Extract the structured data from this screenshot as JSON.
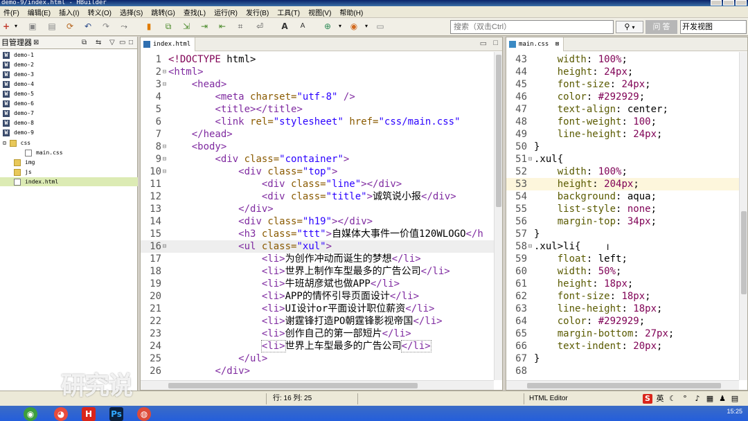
{
  "window": {
    "title": "demo-9/index.html - HBuilder"
  },
  "menu": [
    "件(F)",
    "编辑(E)",
    "插入(I)",
    "转义(O)",
    "选择(S)",
    "跳转(G)",
    "查找(L)",
    "运行(R)",
    "发行(B)",
    "工具(T)",
    "视图(V)",
    "帮助(H)"
  ],
  "toolbar": {
    "search_placeholder": "搜索（双击Ctrl）",
    "ask_label": "问 答",
    "perspective_label": "开发视图"
  },
  "project": {
    "title": "目管理器",
    "items": [
      {
        "label": "demo-1",
        "type": "project"
      },
      {
        "label": "demo-2",
        "type": "project"
      },
      {
        "label": "demo-3",
        "type": "project"
      },
      {
        "label": "demo-4",
        "type": "project"
      },
      {
        "label": "demo-5",
        "type": "project"
      },
      {
        "label": "demo-6",
        "type": "project"
      },
      {
        "label": "demo-7",
        "type": "project"
      },
      {
        "label": "demo-8",
        "type": "project"
      },
      {
        "label": "demo-9",
        "type": "project"
      },
      {
        "label": "css",
        "type": "folder",
        "expand": "⊟"
      },
      {
        "label": "main.css",
        "type": "file"
      },
      {
        "label": "img",
        "type": "folder"
      },
      {
        "label": "js",
        "type": "folder"
      },
      {
        "label": "index.html",
        "type": "file",
        "selected": true
      }
    ]
  },
  "html_editor": {
    "tab": "index.html",
    "lines": [
      {
        "n": "1",
        "fold": "",
        "html": "<span class=\"kw\">&lt;!DOCTYPE</span> <span class=\"txt\">html&gt;</span>"
      },
      {
        "n": "2",
        "fold": "⊟",
        "html": "<span class=\"tag\">&lt;html&gt;</span>"
      },
      {
        "n": "3",
        "fold": "⊟",
        "html": "    <span class=\"tag\">&lt;head&gt;</span>"
      },
      {
        "n": "4",
        "fold": "",
        "html": "        <span class=\"tag\">&lt;meta</span> <span class=\"attr\">charset=</span><span class=\"val\">\"utf-8\"</span> <span class=\"tag\">/&gt;</span>"
      },
      {
        "n": "5",
        "fold": "",
        "html": "        <span class=\"tag\">&lt;title&gt;&lt;/title&gt;</span>"
      },
      {
        "n": "6",
        "fold": "",
        "html": "        <span class=\"tag\">&lt;link</span> <span class=\"attr\">rel=</span><span class=\"val\">\"stylesheet\"</span> <span class=\"attr\">href=</span><span class=\"val\">\"css/main.css\"</span>"
      },
      {
        "n": "7",
        "fold": "",
        "html": "    <span class=\"tag\">&lt;/head&gt;</span>"
      },
      {
        "n": "8",
        "fold": "⊟",
        "html": "    <span class=\"tag\">&lt;body&gt;</span>"
      },
      {
        "n": "9",
        "fold": "⊟",
        "html": "        <span class=\"tag\">&lt;div</span> <span class=\"attr\">class=</span><span class=\"val\">\"container\"</span><span class=\"tag\">&gt;</span>"
      },
      {
        "n": "10",
        "fold": "⊟",
        "html": "            <span class=\"tag\">&lt;div</span> <span class=\"attr\">class=</span><span class=\"val\">\"top\"</span><span class=\"tag\">&gt;</span>"
      },
      {
        "n": "11",
        "fold": "",
        "html": "                <span class=\"tag\">&lt;div</span> <span class=\"attr\">class=</span><span class=\"val\">\"line\"</span><span class=\"tag\">&gt;&lt;/div&gt;</span>"
      },
      {
        "n": "12",
        "fold": "",
        "html": "                <span class=\"tag\">&lt;div</span> <span class=\"attr\">class=</span><span class=\"val\">\"title\"</span><span class=\"tag\">&gt;</span><span class=\"txt\">诚筑说小报</span><span class=\"tag\">&lt;/div&gt;</span>"
      },
      {
        "n": "13",
        "fold": "",
        "html": "            <span class=\"tag\">&lt;/div&gt;</span>"
      },
      {
        "n": "14",
        "fold": "",
        "html": "            <span class=\"tag\">&lt;div</span> <span class=\"attr\">class=</span><span class=\"val\">\"h19\"</span><span class=\"tag\">&gt;&lt;/div&gt;</span>"
      },
      {
        "n": "15",
        "fold": "",
        "html": "            <span class=\"tag\">&lt;h3</span> <span class=\"attr\">class=</span><span class=\"val\">\"ttt\"</span><span class=\"tag\">&gt;</span><span class=\"txt\">自媒体大事件一价值120WLOGO</span><span class=\"tag\">&lt;/h</span>"
      },
      {
        "n": "16",
        "fold": "⊟",
        "html": "            <span class=\"tag\">&lt;ul</span> <span class=\"attr\">class=</span><span class=\"val\">\"xul\"</span><span class=\"tag\">&gt;</span>",
        "hl": true
      },
      {
        "n": "17",
        "fold": "",
        "html": "                <span class=\"tag\">&lt;li&gt;</span><span class=\"txt\">为创作冲动而诞生的梦想</span><span class=\"tag\">&lt;/li&gt;</span>"
      },
      {
        "n": "18",
        "fold": "",
        "html": "                <span class=\"tag\">&lt;li&gt;</span><span class=\"txt\">世界上制作车型最多的广告公司</span><span class=\"tag\">&lt;/li&gt;</span>"
      },
      {
        "n": "19",
        "fold": "",
        "html": "                <span class=\"tag\">&lt;li&gt;</span><span class=\"txt\">牛班胡彦斌也做APP</span><span class=\"tag\">&lt;/li&gt;</span>"
      },
      {
        "n": "20",
        "fold": "",
        "html": "                <span class=\"tag\">&lt;li&gt;</span><span class=\"txt\">APP的情怀引导页面设计</span><span class=\"tag\">&lt;/li&gt;</span>"
      },
      {
        "n": "21",
        "fold": "",
        "html": "                <span class=\"tag\">&lt;li&gt;</span><span class=\"txt\">UI设计or平面设计职位薪资</span><span class=\"tag\">&lt;/li&gt;</span>"
      },
      {
        "n": "22",
        "fold": "",
        "html": "                <span class=\"tag\">&lt;li&gt;</span><span class=\"txt\">谢霆锋打造PO朝霆锋影视帝国</span><span class=\"tag\">&lt;/li&gt;</span>"
      },
      {
        "n": "23",
        "fold": "",
        "html": "                <span class=\"tag\">&lt;li&gt;</span><span class=\"txt\">创作自己的第一部短片</span><span class=\"tag\">&lt;/li&gt;</span>"
      },
      {
        "n": "24",
        "fold": "",
        "html": "                <span class=\"tag\" style=\"outline:1px dotted #888\">&lt;li&gt;</span><span class=\"txt\">世界上车型最多的广告公司</span><span class=\"tag\" style=\"outline:1px dotted #888\">&lt;/li&gt;</span>"
      },
      {
        "n": "25",
        "fold": "",
        "html": "            <span class=\"tag\">&lt;/ul&gt;</span>"
      },
      {
        "n": "26",
        "fold": "",
        "html": "        <span class=\"tag\">&lt;/div&gt;</span>"
      }
    ]
  },
  "css_editor": {
    "tab": "main.css",
    "lines": [
      {
        "n": "43",
        "fold": "",
        "html": "    <span class=\"prop\">width</span>: <span class=\"num\">100%</span>;"
      },
      {
        "n": "44",
        "fold": "",
        "html": "    <span class=\"prop\">height</span>: <span class=\"num\">24px</span>;"
      },
      {
        "n": "45",
        "fold": "",
        "html": "    <span class=\"prop\">font-size</span>: <span class=\"num\">24px</span>;"
      },
      {
        "n": "46",
        "fold": "",
        "html": "    <span class=\"prop\">color</span>: <span class=\"hex\">#292929</span>;"
      },
      {
        "n": "47",
        "fold": "",
        "html": "    <span class=\"prop\">text-align</span>: <span class=\"txt\">center</span>;"
      },
      {
        "n": "48",
        "fold": "",
        "html": "    <span class=\"prop\">font-weight</span>: <span class=\"num\">100</span>;"
      },
      {
        "n": "49",
        "fold": "",
        "html": "    <span class=\"prop\">line-height</span>: <span class=\"num\">24px</span>;"
      },
      {
        "n": "50",
        "fold": "",
        "html": "}"
      },
      {
        "n": "51",
        "fold": "⊟",
        "html": "<span class=\"sel\">.xul</span>{"
      },
      {
        "n": "52",
        "fold": "",
        "html": "    <span class=\"prop\">width</span>: <span class=\"num\">100%</span>;"
      },
      {
        "n": "53",
        "fold": "",
        "html": "    <span class=\"prop\">height</span>: <span class=\"num\">204px</span>;",
        "hl": true
      },
      {
        "n": "54",
        "fold": "",
        "html": "    <span class=\"prop\">background</span>: <span class=\"txt\">aqua</span>;"
      },
      {
        "n": "55",
        "fold": "",
        "html": "    <span class=\"prop\">list-style</span>: <span class=\"num\">none</span>;"
      },
      {
        "n": "56",
        "fold": "",
        "html": "    <span class=\"prop\">margin-top</span>: <span class=\"num\">34px</span>;"
      },
      {
        "n": "57",
        "fold": "",
        "html": "}"
      },
      {
        "n": "58",
        "fold": "⊟",
        "html": "<span class=\"sel\">.xul&gt;li</span>{"
      },
      {
        "n": "59",
        "fold": "",
        "html": "    <span class=\"prop\">float</span>: <span class=\"txt\">left</span>;"
      },
      {
        "n": "60",
        "fold": "",
        "html": "    <span class=\"prop\">width</span>: <span class=\"num\">50%</span>;"
      },
      {
        "n": "61",
        "fold": "",
        "html": "    <span class=\"prop\">height</span>: <span class=\"num\">18px</span>;"
      },
      {
        "n": "62",
        "fold": "",
        "html": "    <span class=\"prop\">font-size</span>: <span class=\"num\">18px</span>;"
      },
      {
        "n": "63",
        "fold": "",
        "html": "    <span class=\"prop\">line-height</span>: <span class=\"num\">18px</span>;"
      },
      {
        "n": "64",
        "fold": "",
        "html": "    <span class=\"prop\">color</span>: <span class=\"hex\">#292929</span>;"
      },
      {
        "n": "65",
        "fold": "",
        "html": "    <span class=\"prop\">margin-bottom</span>: <span class=\"num\">27px</span>;"
      },
      {
        "n": "66",
        "fold": "",
        "html": "    <span class=\"prop\">text-indent</span>: <span class=\"num\">20px</span>;"
      },
      {
        "n": "67",
        "fold": "",
        "html": "}"
      },
      {
        "n": "68",
        "fold": "",
        "html": ""
      }
    ]
  },
  "status": {
    "position": "行: 16 列: 25",
    "mode": "HTML Editor"
  },
  "taskbar": {
    "clock": "15:25"
  },
  "watermark": "研究说"
}
